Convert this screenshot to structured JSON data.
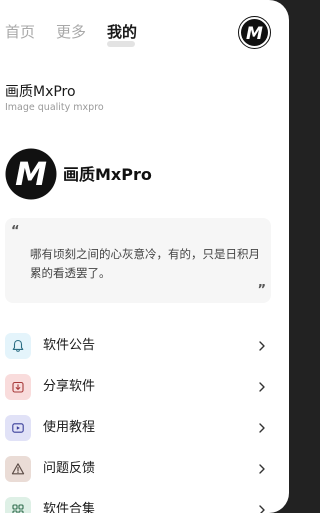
{
  "tabs": [
    {
      "label": "首页",
      "active": false
    },
    {
      "label": "更多",
      "active": false
    },
    {
      "label": "我的",
      "active": true
    }
  ],
  "app": {
    "title": "画质MxPro",
    "subtitle": "Image quality mxpro"
  },
  "profile": {
    "name": "画质MxPro",
    "logo_letter": "M"
  },
  "quote": {
    "open_mark": "“",
    "close_mark": "”",
    "text": "哪有顷刻之间的心灰意冷，有的，只是日积月累的看透罢了。"
  },
  "menu": [
    {
      "label": "软件公告",
      "icon": "bell-icon",
      "bg": "#e4f4fb",
      "fg": "#2b6d83"
    },
    {
      "label": "分享软件",
      "icon": "share-icon",
      "bg": "#f9dcdc",
      "fg": "#a83a3a"
    },
    {
      "label": "使用教程",
      "icon": "video-icon",
      "bg": "#e1e2f7",
      "fg": "#3b3f9a"
    },
    {
      "label": "问题反馈",
      "icon": "warning-icon",
      "bg": "#eadcd6",
      "fg": "#5a4a44"
    },
    {
      "label": "软件合集",
      "icon": "apps-icon",
      "bg": "#def0e6",
      "fg": "#2e6b4c"
    }
  ],
  "colors": {
    "active_tab": "#1a1a1a",
    "inactive_tab": "#a9a9a9",
    "card_bg": "#f6f6f6"
  }
}
